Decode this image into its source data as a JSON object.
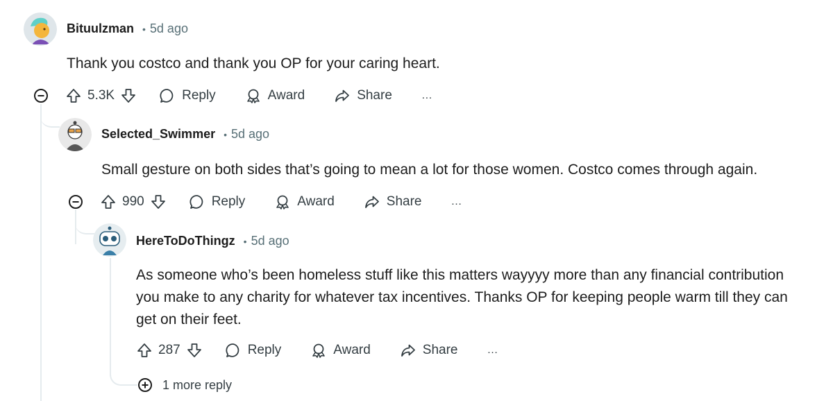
{
  "comments": [
    {
      "author": "Bituulzman",
      "time": "5d ago",
      "body": "Thank you costco and thank you OP for your caring heart.",
      "score": "5.3K"
    },
    {
      "author": "Selected_Swimmer",
      "time": "5d ago",
      "body": "Small gesture on both sides that’s going to mean a lot for those women. Costco comes through again.",
      "score": "990"
    },
    {
      "author": "HereToDoThingz",
      "time": "5d ago",
      "body": "As someone who’s been homeless stuff like this matters wayyyy more than any financial contribution you make to any charity for whatever tax incentives. Thanks OP for keeping people warm till they can get on their feet.",
      "score": "287"
    }
  ],
  "labels": {
    "separator": "•",
    "reply": "Reply",
    "award": "Award",
    "share": "Share",
    "overflow": "…",
    "more_replies": "1 more reply"
  },
  "colors": {
    "thread_line": "#e5ebee",
    "meta_gray": "#576f76",
    "action_gray": "#333d42"
  },
  "icons": [
    "upvote-icon",
    "downvote-icon",
    "comment-icon",
    "award-icon",
    "share-icon",
    "collapse-icon",
    "expand-icon",
    "overflow-icon"
  ]
}
